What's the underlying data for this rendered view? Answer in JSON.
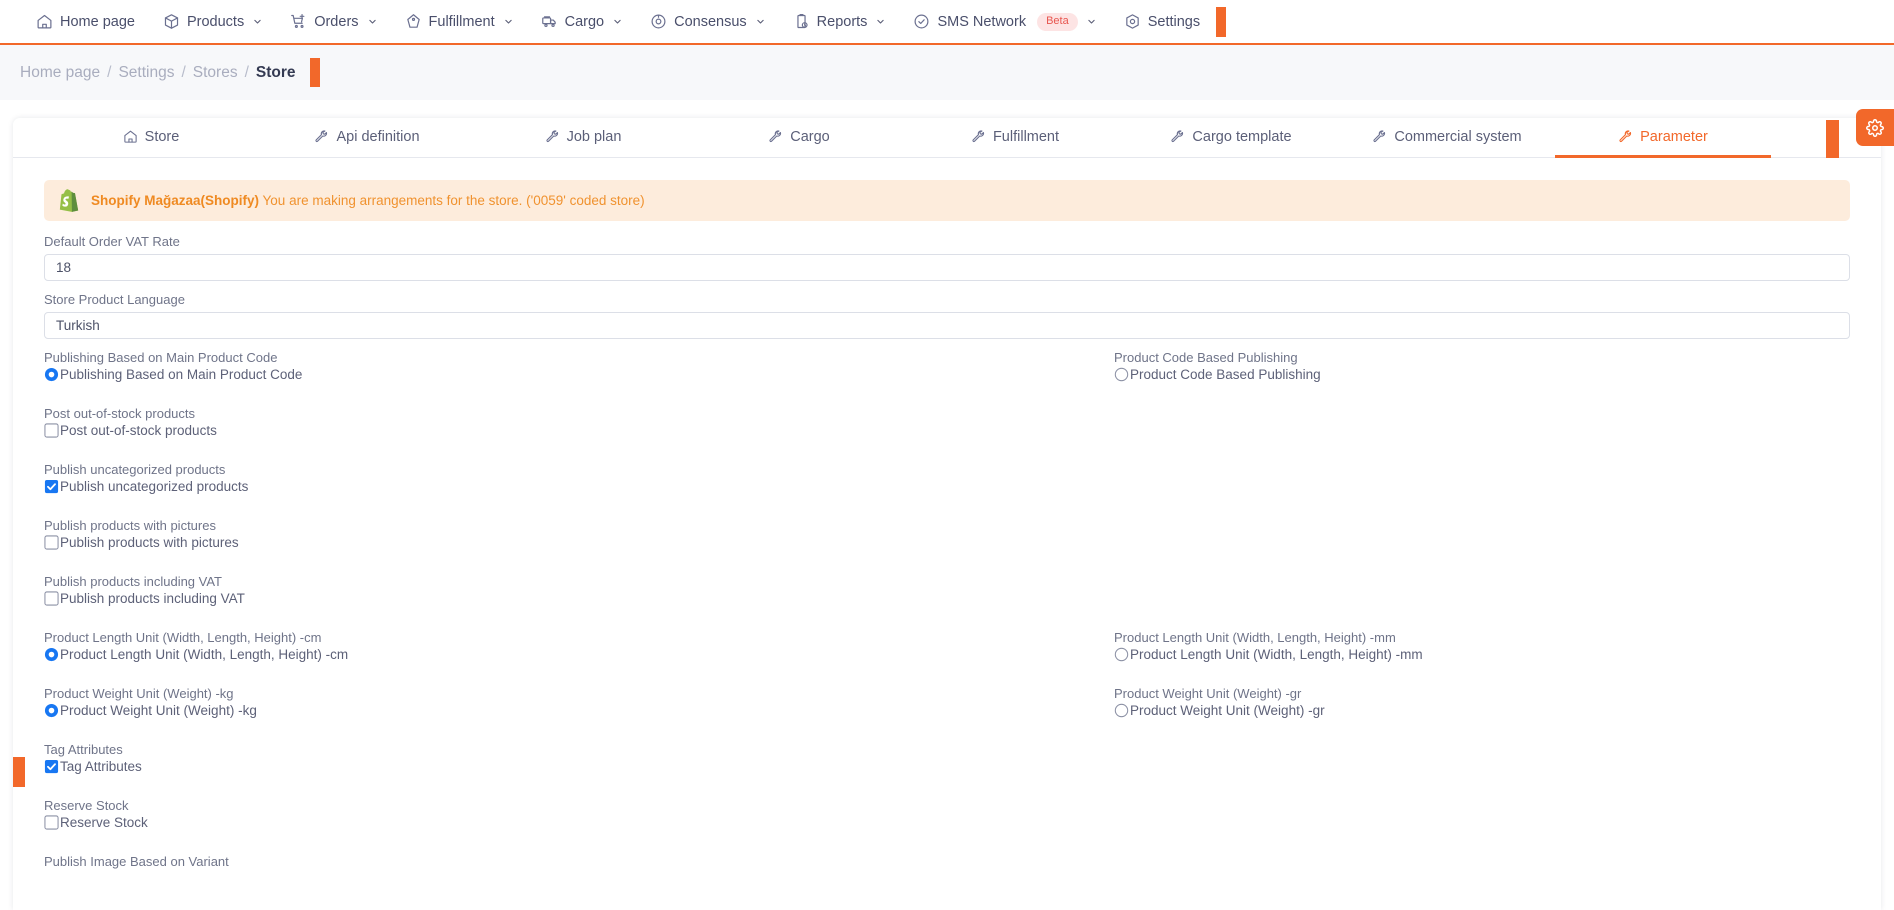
{
  "colors": {
    "accent": "#f2682a",
    "active_tab": "#f2682a",
    "alert_bg": "#fdecdc",
    "alert_text": "#f0922f",
    "checked_blue": "#1877f2",
    "label_gray": "#6f7489",
    "beta_badge_bg": "#fde4e4",
    "beta_badge_text": "#e8564f",
    "shopify_green": "#95bf47"
  },
  "topnav": {
    "items": [
      {
        "label": "Home page",
        "icon": "home-icon",
        "has_caret": false,
        "badge": null
      },
      {
        "label": "Products",
        "icon": "box-icon",
        "has_caret": true,
        "badge": null
      },
      {
        "label": "Orders",
        "icon": "cart-plus-icon",
        "has_caret": true,
        "badge": null
      },
      {
        "label": "Fulfillment",
        "icon": "tag-icon",
        "has_caret": true,
        "badge": null
      },
      {
        "label": "Cargo",
        "icon": "truck-icon",
        "has_caret": true,
        "badge": null
      },
      {
        "label": "Consensus",
        "icon": "target-icon",
        "has_caret": true,
        "badge": null
      },
      {
        "label": "Reports",
        "icon": "clipboard-clock-icon",
        "has_caret": true,
        "badge": null
      },
      {
        "label": "SMS Network",
        "icon": "check-circle-icon",
        "has_caret": true,
        "badge": "Beta"
      },
      {
        "label": "Settings",
        "icon": "hexagon-gear-icon",
        "has_caret": false,
        "badge": null
      }
    ]
  },
  "breadcrumb": {
    "items": [
      "Home page",
      "Settings",
      "Stores",
      "Store"
    ],
    "separator": "/",
    "current_index": 3
  },
  "tabs": [
    {
      "label": "Store",
      "icon": "home-icon",
      "active": false
    },
    {
      "label": "Api definition",
      "icon": "wrench-icon",
      "active": false
    },
    {
      "label": "Job plan",
      "icon": "wrench-icon",
      "active": false
    },
    {
      "label": "Cargo",
      "icon": "wrench-icon",
      "active": false
    },
    {
      "label": "Fulfillment",
      "icon": "wrench-icon",
      "active": false
    },
    {
      "label": "Cargo template",
      "icon": "wrench-icon",
      "active": false
    },
    {
      "label": "Commercial system",
      "icon": "wrench-icon",
      "active": false
    },
    {
      "label": "Parameter",
      "icon": "wrench-icon",
      "active": true
    }
  ],
  "gear_fab": {
    "icon": "gear-icon"
  },
  "alert": {
    "icon": "shopify-icon",
    "strong": "Shopify Mağazaa(Shopify)",
    "message": "You are making arrangements for the store. ('0059' coded store)"
  },
  "form": {
    "fields": [
      {
        "label": "Default Order VAT Rate",
        "value": "18",
        "placeholder": ""
      },
      {
        "label": "Store Product Language",
        "value": "Turkish",
        "placeholder": ""
      }
    ],
    "options": [
      {
        "title": "Publishing Based on Main Product Code",
        "type": "radio",
        "choice_label": "Publishing Based on Main Product Code",
        "checked": true,
        "pair": {
          "title": "Product Code Based Publishing",
          "type": "radio",
          "choice_label": "Product Code Based Publishing",
          "checked": false
        }
      },
      {
        "title": "Post out-of-stock products",
        "type": "checkbox",
        "choice_label": "Post out-of-stock products",
        "checked": false,
        "pair": null
      },
      {
        "title": "Publish uncategorized products",
        "type": "checkbox",
        "choice_label": "Publish uncategorized products",
        "checked": true,
        "pair": null
      },
      {
        "title": "Publish products with pictures",
        "type": "checkbox",
        "choice_label": "Publish products with pictures",
        "checked": false,
        "pair": null
      },
      {
        "title": "Publish products including VAT",
        "type": "checkbox",
        "choice_label": "Publish products including VAT",
        "checked": false,
        "pair": null
      },
      {
        "title": "Product Length Unit (Width, Length, Height) -cm",
        "type": "radio",
        "choice_label": "Product Length Unit (Width, Length, Height) -cm",
        "checked": true,
        "pair": {
          "title": "Product Length Unit (Width, Length, Height) -mm",
          "type": "radio",
          "choice_label": "Product Length Unit (Width, Length, Height) -mm",
          "checked": false
        }
      },
      {
        "title": "Product Weight Unit (Weight) -kg",
        "type": "radio",
        "choice_label": "Product Weight Unit (Weight) -kg",
        "checked": true,
        "pair": {
          "title": "Product Weight Unit (Weight) -gr",
          "type": "radio",
          "choice_label": "Product Weight Unit (Weight) -gr",
          "checked": false
        }
      },
      {
        "title": "Tag Attributes",
        "type": "checkbox",
        "choice_label": "Tag Attributes",
        "checked": true,
        "pair": null
      },
      {
        "title": "Reserve Stock",
        "type": "checkbox",
        "choice_label": "Reserve Stock",
        "checked": false,
        "pair": null
      },
      {
        "title": "Publish Image Based on Variant",
        "type": "checkbox",
        "choice_label": "",
        "checked": false,
        "pair": null
      }
    ]
  }
}
